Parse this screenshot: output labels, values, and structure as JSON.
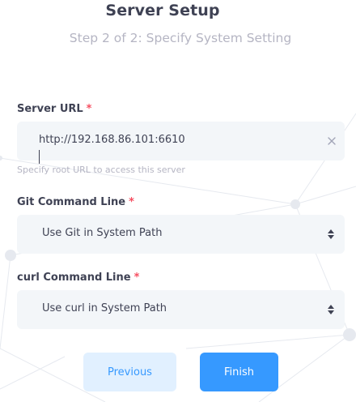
{
  "header": {
    "title": "Server Setup",
    "subtitle": "Step 2 of 2: Specify System Setting"
  },
  "form": {
    "server_url": {
      "label": "Server URL",
      "required_mark": "*",
      "value": "http://192.168.86.101:6610",
      "hint": "Specify root URL to access this server"
    },
    "git_command": {
      "label": "Git Command Line",
      "required_mark": "*",
      "selected": "Use Git in System Path"
    },
    "curl_command": {
      "label": "curl Command Line",
      "required_mark": "*",
      "selected": "Use curl in System Path"
    }
  },
  "actions": {
    "previous_label": "Previous",
    "finish_label": "Finish"
  },
  "colors": {
    "primary": "#3699ff",
    "primary_light": "#e1f0ff",
    "required": "#f64e60",
    "field_bg": "#f3f6f9",
    "text": "#3f4254",
    "muted": "#b5b5c3"
  },
  "icons": {
    "clear": "close-icon",
    "select": "sort-arrows-icon"
  }
}
